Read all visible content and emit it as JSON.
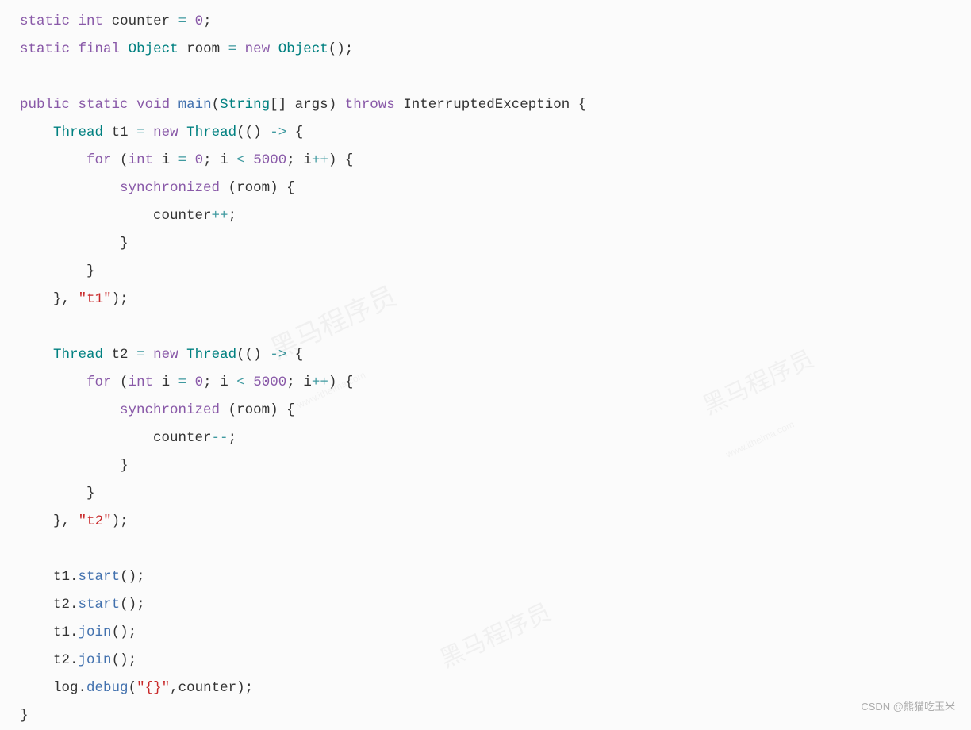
{
  "code": {
    "l1": {
      "kw_static": "static",
      "kw_int": "int",
      "name": "counter",
      "eq": "=",
      "val": "0",
      "semi": ";"
    },
    "l2": {
      "kw_static": "static",
      "kw_final": "final",
      "type": "Object",
      "name": "room",
      "eq": "=",
      "kw_new": "new",
      "ctor": "Object",
      "parens": "()",
      "semi": ";"
    },
    "l4": {
      "kw_public": "public",
      "kw_static": "static",
      "kw_void": "void",
      "method": "main",
      "lp": "(",
      "ptype": "String",
      "brackets": "[]",
      "pname": "args",
      "rp": ")",
      "kw_throws": "throws",
      "exc": "InterruptedException",
      "brace": "{"
    },
    "l5": {
      "type": "Thread",
      "name": "t1",
      "eq": "=",
      "kw_new": "new",
      "ctor": "Thread",
      "lp": "(",
      "lambda": "()",
      "arrow": "->",
      "brace": "{"
    },
    "l6": {
      "kw_for": "for",
      "lp": "(",
      "kw_int": "int",
      "var": "i",
      "eq": "=",
      "zero": "0",
      "sc1": ";",
      "var2": "i",
      "lt": "<",
      "lim": "5000",
      "sc2": ";",
      "var3": "i",
      "inc": "++",
      "rp": ")",
      "brace": "{"
    },
    "l7": {
      "kw_sync": "synchronized",
      "lp": "(",
      "obj": "room",
      "rp": ")",
      "brace": "{"
    },
    "l8": {
      "var": "counter",
      "op": "++",
      "semi": ";"
    },
    "l9": {
      "brace": "}"
    },
    "l10": {
      "brace": "}"
    },
    "l11": {
      "brace": "}",
      "comma": ",",
      "str": "\"t1\"",
      "rp": ")",
      "semi": ";"
    },
    "l13": {
      "type": "Thread",
      "name": "t2",
      "eq": "=",
      "kw_new": "new",
      "ctor": "Thread",
      "lp": "(",
      "lambda": "()",
      "arrow": "->",
      "brace": "{"
    },
    "l14": {
      "kw_for": "for",
      "lp": "(",
      "kw_int": "int",
      "var": "i",
      "eq": "=",
      "zero": "0",
      "sc1": ";",
      "var2": "i",
      "lt": "<",
      "lim": "5000",
      "sc2": ";",
      "var3": "i",
      "inc": "++",
      "rp": ")",
      "brace": "{"
    },
    "l15": {
      "kw_sync": "synchronized",
      "lp": "(",
      "obj": "room",
      "rp": ")",
      "brace": "{"
    },
    "l16": {
      "var": "counter",
      "op": "--",
      "semi": ";"
    },
    "l17": {
      "brace": "}"
    },
    "l18": {
      "brace": "}"
    },
    "l19": {
      "brace": "}",
      "comma": ",",
      "str": "\"t2\"",
      "rp": ")",
      "semi": ";"
    },
    "l21": {
      "obj": "t1",
      "dot": ".",
      "method": "start",
      "parens": "()",
      "semi": ";"
    },
    "l22": {
      "obj": "t2",
      "dot": ".",
      "method": "start",
      "parens": "()",
      "semi": ";"
    },
    "l23": {
      "obj": "t1",
      "dot": ".",
      "method": "join",
      "parens": "()",
      "semi": ";"
    },
    "l24": {
      "obj": "t2",
      "dot": ".",
      "method": "join",
      "parens": "()",
      "semi": ";"
    },
    "l25": {
      "obj": "log",
      "dot": ".",
      "method": "debug",
      "lp": "(",
      "str": "\"{}\"",
      "comma": ",",
      "arg": "counter",
      "rp": ")",
      "semi": ";"
    },
    "l26": {
      "brace": "}"
    }
  },
  "watermark": {
    "attribution": "CSDN @熊猫吃玉米",
    "brand": "黑马程序员",
    "url": "www.itheima.com"
  }
}
